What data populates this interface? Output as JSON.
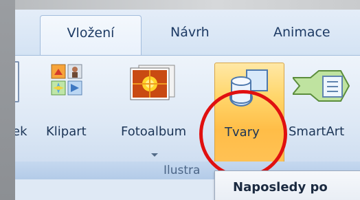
{
  "tabs": {
    "active": "Vložení",
    "items": [
      "Návrh",
      "Animace"
    ]
  },
  "ribbon": {
    "buttons": {
      "obrazek": "ek",
      "klipart": "Klipart",
      "fotoalbum": "Fotoalbum",
      "tvary": "Tvary",
      "smartart": "SmartArt"
    },
    "group_label": "Ilustra"
  },
  "dropdown": {
    "header": "Naposledy po"
  },
  "colors": {
    "highlight_ring": "#e01010",
    "active_button": "#ffc35a",
    "tab_text": "#1d3a64"
  },
  "icons": [
    "picture-icon",
    "clipart-icon",
    "photo-album-icon",
    "shapes-icon",
    "smartart-icon",
    "chevron-down-icon"
  ]
}
